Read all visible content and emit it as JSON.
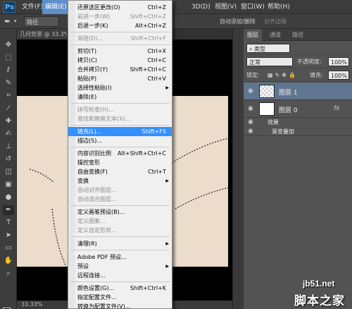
{
  "app": {
    "logo": "Ps"
  },
  "menubar": {
    "items": [
      {
        "label": "文件(F)"
      },
      {
        "label": "编辑(E)"
      },
      {
        "label": "3D(D)"
      },
      {
        "label": "视图(V)"
      },
      {
        "label": "窗口(W)"
      },
      {
        "label": "帮助(H)"
      }
    ]
  },
  "options": {
    "mode_value": "路径",
    "auto_add_delete": "自动添加/删除",
    "align_edges": "对齐边缘"
  },
  "document": {
    "tab_title": "几何背景 @ 33.3%",
    "zoom_status": "33.33%"
  },
  "panel": {
    "tabs": [
      {
        "label": "图层"
      },
      {
        "label": "通道"
      },
      {
        "label": "路径"
      }
    ],
    "filter_label": "类型",
    "blend_mode": "正常",
    "opacity_label": "不透明度:",
    "opacity_value": "100%",
    "lock_label": "锁定:",
    "fill_label": "填充:",
    "fill_value": "100%",
    "layers": [
      {
        "name": "图层 1"
      },
      {
        "name": "图层 0"
      }
    ],
    "effects_label": "效果",
    "effect_item": "渐变叠加",
    "fx": "fx"
  },
  "edit_menu": {
    "items": [
      {
        "label": "还原选区更改(O)",
        "shortcut": "Ctrl+Z"
      },
      {
        "label": "前进一步(W)",
        "shortcut": "Shift+Ctrl+Z"
      },
      {
        "label": "后退一步(K)",
        "shortcut": "Alt+Ctrl+Z"
      },
      {
        "label": "渐隐(D)...",
        "shortcut": "Shift+Ctrl+F"
      },
      {
        "label": "剪切(T)",
        "shortcut": "Ctrl+X"
      },
      {
        "label": "拷贝(C)",
        "shortcut": "Ctrl+C"
      },
      {
        "label": "合并拷贝(Y)",
        "shortcut": "Shift+Ctrl+C"
      },
      {
        "label": "粘贴(P)",
        "shortcut": "Ctrl+V"
      },
      {
        "label": "选择性粘贴(I)",
        "shortcut": ""
      },
      {
        "label": "清除(E)",
        "shortcut": ""
      },
      {
        "label": "拼写检查(H)...",
        "shortcut": ""
      },
      {
        "label": "查找和替换文本(X)...",
        "shortcut": ""
      },
      {
        "label": "填充(L)...",
        "shortcut": "Shift+F5"
      },
      {
        "label": "描边(S)...",
        "shortcut": ""
      },
      {
        "label": "内容识别比例",
        "shortcut": "Alt+Shift+Ctrl+C"
      },
      {
        "label": "操控变形",
        "shortcut": ""
      },
      {
        "label": "自由变换(F)",
        "shortcut": "Ctrl+T"
      },
      {
        "label": "变换",
        "shortcut": ""
      },
      {
        "label": "自动对齐图层...",
        "shortcut": ""
      },
      {
        "label": "自动混合图层...",
        "shortcut": ""
      },
      {
        "label": "定义画笔预设(B)...",
        "shortcut": ""
      },
      {
        "label": "定义图案...",
        "shortcut": ""
      },
      {
        "label": "定义自定形状...",
        "shortcut": ""
      },
      {
        "label": "清理(R)",
        "shortcut": ""
      },
      {
        "label": "Adobe PDF 预设...",
        "shortcut": ""
      },
      {
        "label": "预设",
        "shortcut": ""
      },
      {
        "label": "远程连接...",
        "shortcut": ""
      },
      {
        "label": "颜色设置(G)...",
        "shortcut": "Shift+Ctrl+K"
      },
      {
        "label": "指定配置文件...",
        "shortcut": ""
      },
      {
        "label": "转换为配置文件(V)...",
        "shortcut": ""
      }
    ]
  },
  "watermark": {
    "line1": "jb51.net",
    "line2": "脚本之家"
  }
}
